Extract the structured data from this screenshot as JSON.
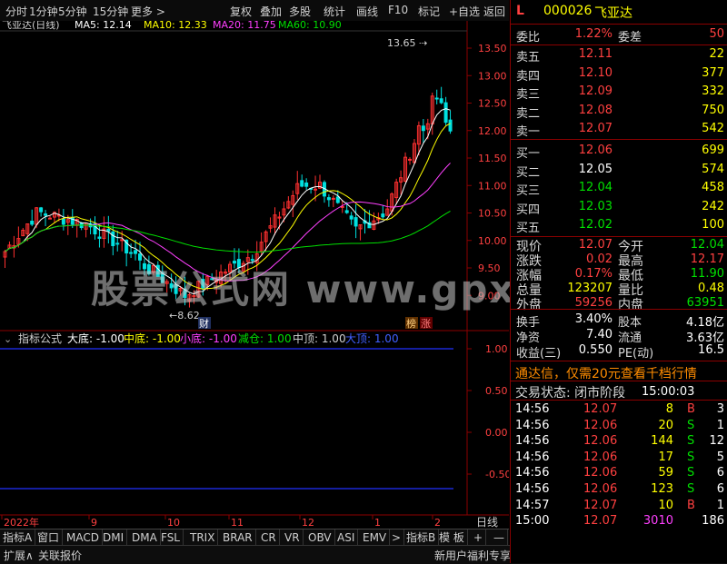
{
  "toolbar": {
    "left": [
      "分时",
      "1分钟",
      "5分钟",
      "15分钟",
      "更多 >"
    ],
    "right": [
      "复权",
      "叠加",
      "多股",
      "统计",
      "画线",
      "F10",
      "标记",
      "+自选",
      "返回"
    ]
  },
  "chart": {
    "title": "飞亚达(日线)",
    "ma": [
      {
        "label": "MA5: 12.14",
        "color": "#ffffff"
      },
      {
        "label": "MA10: 12.33",
        "color": "#ffff00"
      },
      {
        "label": "MA20: 11.75",
        "color": "#ff40ff"
      },
      {
        "label": "MA60: 10.90",
        "color": "#00e000"
      }
    ],
    "price_axis": [
      "13.50",
      "13.00",
      "12.50",
      "12.00",
      "11.50",
      "11.00",
      "10.50",
      "10.00",
      "9.50",
      "9.00"
    ],
    "high_label": "13.65",
    "low_label": "8.62",
    "markers": [
      "财",
      "榜",
      "涨"
    ],
    "watermark": "股票公式网  www.gpxs.com"
  },
  "indicator": {
    "title": "指标公式",
    "items": [
      {
        "label": "大底: -1.00",
        "color": "#ffffff"
      },
      {
        "label": "中底: -1.00",
        "color": "#ffff00"
      },
      {
        "label": "小底: -1.00",
        "color": "#ff40ff"
      },
      {
        "label": "减仓: 1.00",
        "color": "#00e000"
      },
      {
        "label": "中顶: 1.00",
        "color": "#d0d0d0"
      },
      {
        "label": "大顶: 1.00",
        "color": "#4060ff"
      }
    ],
    "axis": [
      "1.00",
      "0.50",
      "0.00",
      "-0.50"
    ]
  },
  "time_axis": [
    "2022年",
    "9",
    "10",
    "11",
    "12",
    "1",
    "2"
  ],
  "period": "日线",
  "tabs": [
    "指标A",
    "窗口",
    "MACD",
    "DMI",
    "DMA",
    "FSL",
    "TRIX",
    "BRAR",
    "CR",
    "VR",
    "OBV",
    "ASI",
    "EMV",
    ">",
    "指标B",
    "模 板",
    "+",
    "—"
  ],
  "status_left": [
    "扩展∧",
    "关联报价"
  ],
  "status_center": "新用户福利专享",
  "status_right": [
    "笔",
    "价",
    "细",
    "势",
    "联",
    "值",
    "主",
    "筹"
  ],
  "quote": {
    "marker": "L",
    "code": "000026",
    "name": "飞亚达",
    "weibi_label": "委比",
    "weibi": "1.22%",
    "weicha_label": "委差",
    "weicha": "50",
    "asks": [
      {
        "label": "卖五",
        "price": "12.11",
        "vol": "22"
      },
      {
        "label": "卖四",
        "price": "12.10",
        "vol": "377"
      },
      {
        "label": "卖三",
        "price": "12.09",
        "vol": "332"
      },
      {
        "label": "卖二",
        "price": "12.08",
        "vol": "750"
      },
      {
        "label": "卖一",
        "price": "12.07",
        "vol": "542"
      }
    ],
    "bids": [
      {
        "label": "买一",
        "price": "12.06",
        "vol": "699",
        "color": "red"
      },
      {
        "label": "买二",
        "price": "12.05",
        "vol": "574",
        "color": "white"
      },
      {
        "label": "买三",
        "price": "12.04",
        "vol": "458",
        "color": "green"
      },
      {
        "label": "买四",
        "price": "12.03",
        "vol": "242",
        "color": "green"
      },
      {
        "label": "买五",
        "price": "12.02",
        "vol": "100",
        "color": "green"
      }
    ],
    "stats": [
      {
        "l1": "现价",
        "v1": "12.07",
        "c1": "red",
        "l2": "今开",
        "v2": "12.04",
        "c2": "green"
      },
      {
        "l1": "涨跌",
        "v1": "0.02",
        "c1": "red",
        "l2": "最高",
        "v2": "12.17",
        "c2": "red"
      },
      {
        "l1": "涨幅",
        "v1": "0.17%",
        "c1": "red",
        "l2": "最低",
        "v2": "11.90",
        "c2": "green"
      },
      {
        "l1": "总量",
        "v1": "123207",
        "c1": "yellow",
        "l2": "量比",
        "v2": "0.48",
        "c2": "yellow"
      },
      {
        "l1": "外盘",
        "v1": "59256",
        "c1": "red",
        "l2": "内盘",
        "v2": "63951",
        "c2": "green"
      }
    ],
    "stats2": [
      {
        "l1": "换手",
        "v1": "3.40%",
        "l2": "股本",
        "v2": "4.18亿"
      },
      {
        "l1": "净资",
        "v1": "7.40",
        "l2": "流通",
        "v2": "3.63亿"
      },
      {
        "l1": "收益(三)",
        "v1": "0.550",
        "l2": "PE(动)",
        "v2": "16.5"
      }
    ],
    "ad": "通达信，仅需20元查看千档行情",
    "trade_status_label": "交易状态: 闭市阶段",
    "trade_status_time": "15:00:03",
    "ticks": [
      {
        "time": "14:56",
        "price": "12.07",
        "vol": "8",
        "bs": "B",
        "n": "3",
        "vc": "yellow"
      },
      {
        "time": "14:56",
        "price": "12.06",
        "vol": "20",
        "bs": "S",
        "n": "1",
        "vc": "yellow"
      },
      {
        "time": "14:56",
        "price": "12.06",
        "vol": "144",
        "bs": "S",
        "n": "12",
        "vc": "yellow"
      },
      {
        "time": "14:56",
        "price": "12.06",
        "vol": "17",
        "bs": "S",
        "n": "5",
        "vc": "yellow"
      },
      {
        "time": "14:56",
        "price": "12.06",
        "vol": "59",
        "bs": "S",
        "n": "6",
        "vc": "yellow"
      },
      {
        "time": "14:56",
        "price": "12.06",
        "vol": "123",
        "bs": "S",
        "n": "6",
        "vc": "yellow"
      },
      {
        "time": "14:57",
        "price": "12.07",
        "vol": "10",
        "bs": "B",
        "n": "1",
        "vc": "yellow"
      },
      {
        "time": "15:00",
        "price": "12.07",
        "vol": "3010",
        "bs": "",
        "n": "186",
        "vc": "mag"
      }
    ]
  }
}
